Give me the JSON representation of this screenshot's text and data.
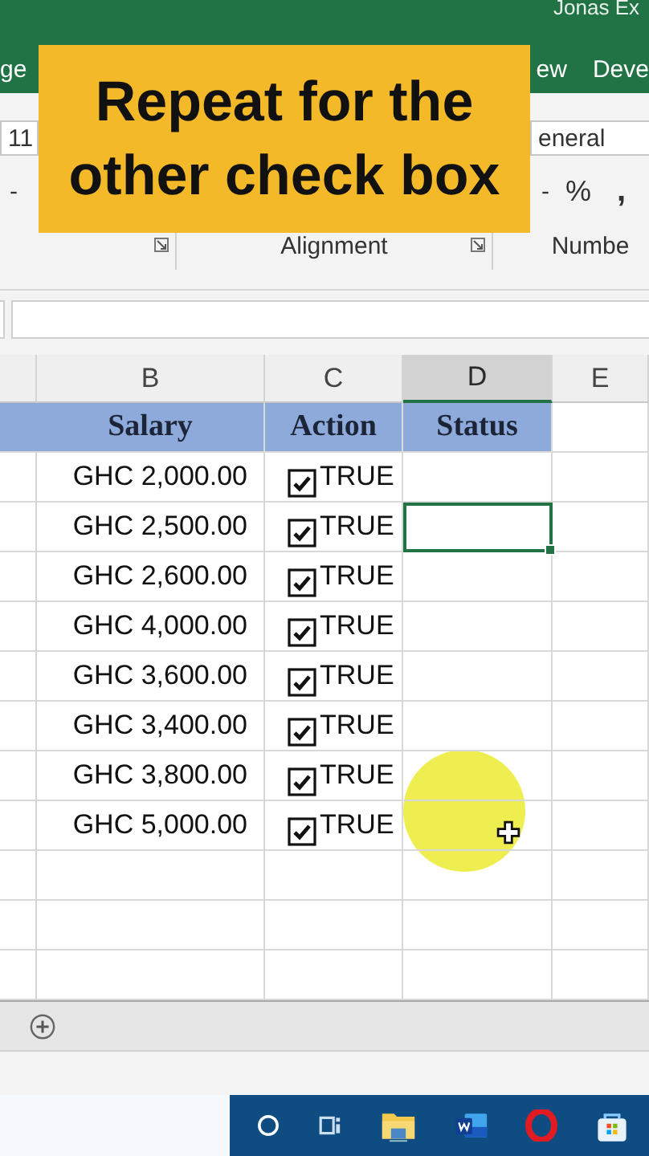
{
  "title_bar": {
    "text": "Jonas Ex"
  },
  "ribbon_tabs": [
    {
      "label": "ge"
    },
    {
      "label": "ew"
    },
    {
      "label": "Deve"
    }
  ],
  "ribbon": {
    "font_size": "11",
    "number_format": "eneral",
    "caret": "-",
    "number_caret": "-",
    "percent": "%",
    "comma": ",",
    "groups": [
      {
        "label": "Alignment"
      },
      {
        "label": "Numbe"
      }
    ]
  },
  "caption": {
    "text": "Repeat for the other check box"
  },
  "columns": [
    {
      "label": "B",
      "selected": false
    },
    {
      "label": "C",
      "selected": false
    },
    {
      "label": "D",
      "selected": true
    },
    {
      "label": "E",
      "selected": false
    }
  ],
  "header": [
    "Salary",
    "Action",
    "Status"
  ],
  "rows": [
    {
      "salary": "GHC 2,000.00",
      "action": "TRUE",
      "checked": true,
      "status_selected": false
    },
    {
      "salary": "GHC 2,500.00",
      "action": "TRUE",
      "checked": true,
      "status_selected": true
    },
    {
      "salary": "GHC 2,600.00",
      "action": "TRUE",
      "checked": true,
      "status_selected": false
    },
    {
      "salary": "GHC 4,000.00",
      "action": "TRUE",
      "checked": true,
      "status_selected": false
    },
    {
      "salary": "GHC 3,600.00",
      "action": "TRUE",
      "checked": true,
      "status_selected": false
    },
    {
      "salary": "GHC 3,400.00",
      "action": "TRUE",
      "checked": true,
      "status_selected": false
    },
    {
      "salary": "GHC 3,800.00",
      "action": "TRUE",
      "checked": true,
      "status_selected": false
    },
    {
      "salary": "GHC 5,000.00",
      "action": "TRUE",
      "checked": true,
      "status_selected": false
    }
  ]
}
